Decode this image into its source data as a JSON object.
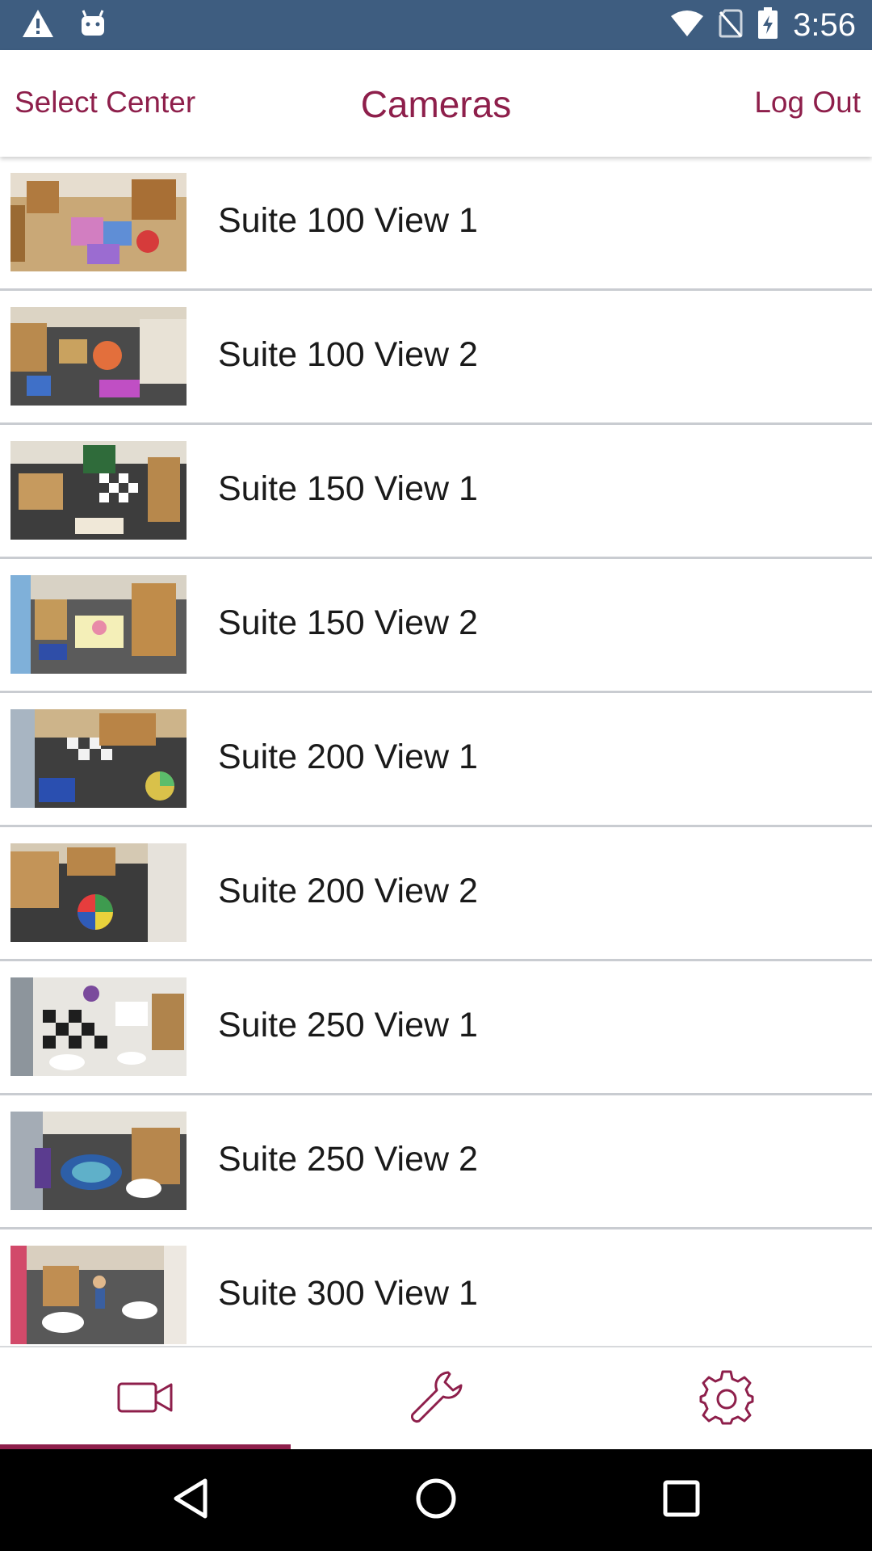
{
  "status_bar": {
    "time": "3:56",
    "left_icons": [
      "warning-icon",
      "android-icon"
    ],
    "right_icons": [
      "wifi-icon",
      "no-sim-icon",
      "battery-charging-icon"
    ]
  },
  "header": {
    "left_action": "Select Center",
    "title": "Cameras",
    "right_action": "Log Out"
  },
  "cameras": [
    {
      "label": "Suite 100 View 1"
    },
    {
      "label": "Suite 100 View 2"
    },
    {
      "label": "Suite 150 View 1"
    },
    {
      "label": "Suite 150 View 2"
    },
    {
      "label": "Suite 200 View 1"
    },
    {
      "label": "Suite 200 View 2"
    },
    {
      "label": "Suite 250 View 1"
    },
    {
      "label": "Suite 250 View 2"
    },
    {
      "label": "Suite 300 View 1"
    }
  ],
  "tabs": [
    {
      "icon": "video-camera-icon",
      "selected": true
    },
    {
      "icon": "wrench-icon",
      "selected": false
    },
    {
      "icon": "gear-icon",
      "selected": false
    }
  ],
  "nav_bar": {
    "icons": [
      "back-icon",
      "home-icon",
      "recents-icon"
    ]
  },
  "colors": {
    "accent": "#8e1f4b",
    "status_bar": "#3e5d80",
    "divider": "#c9ccd1",
    "nav_bar": "#000000"
  }
}
